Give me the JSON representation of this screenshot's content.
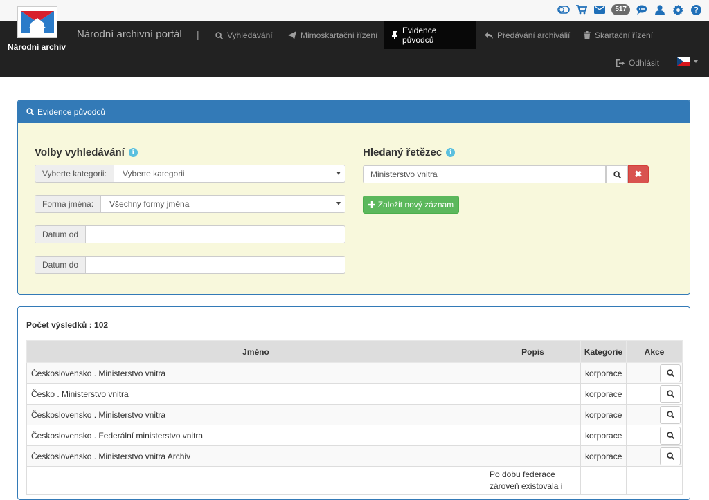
{
  "header": {
    "logo_text": "Národní archiv",
    "brand": "Národní archivní portál",
    "separator": "|",
    "message_count": "517",
    "utility_icons": [
      "toggle-icon",
      "cart-icon",
      "envelope-icon",
      "comments-icon",
      "user-icon",
      "gear-icon",
      "help-icon"
    ],
    "nav": [
      {
        "label": "Vyhledávání",
        "icon": "search-icon"
      },
      {
        "label": "Mimoskartační řízení",
        "icon": "send-icon"
      },
      {
        "label": "Evidence původců",
        "icon": "pin-icon",
        "active": true
      },
      {
        "label": "Předávání archiválií",
        "icon": "reply-icon"
      },
      {
        "label": "Skartační řízení",
        "icon": "trash-icon"
      }
    ],
    "logout": "Odhlásit",
    "language": "cz-flag-icon"
  },
  "panel": {
    "title": "Evidence původců",
    "options_title": "Volby vyhledávání",
    "category_label": "Vyberte kategorii:",
    "category_value": "Vyberte kategorii",
    "name_form_label": "Forma jména:",
    "name_form_value": "Všechny formy jména",
    "date_from_label": "Datum od",
    "date_from_value": "",
    "date_to_label": "Datum do",
    "date_to_value": "",
    "search_title": "Hledaný řetězec",
    "search_value": "Ministerstvo vnitra",
    "new_record": "Založit nový záznam"
  },
  "results": {
    "count_label": "Počet výsledků : 102",
    "columns": [
      "Jméno",
      "Popis",
      "Kategorie",
      "Akce"
    ],
    "rows": [
      {
        "name": "Československo . Ministerstvo vnitra",
        "desc": "",
        "category": "korporace"
      },
      {
        "name": "Česko . Ministerstvo vnitra",
        "desc": "",
        "category": "korporace"
      },
      {
        "name": "Československo . Ministerstvo vnitra",
        "desc": "",
        "category": "korporace"
      },
      {
        "name": "Československo . Federální ministerstvo vnitra",
        "desc": "",
        "category": "korporace"
      },
      {
        "name": "Československo . Ministerstvo vnitra Archiv",
        "desc": "",
        "category": "korporace"
      },
      {
        "name": "",
        "desc": "Po dobu federace zároveň existovala i",
        "category": ""
      }
    ]
  },
  "colors": {
    "navbar": "#222222",
    "primary": "#337ab7",
    "panel_body": "#f8f8dc",
    "success": "#5cb85c",
    "danger": "#d9534f",
    "info": "#5bc0de"
  }
}
